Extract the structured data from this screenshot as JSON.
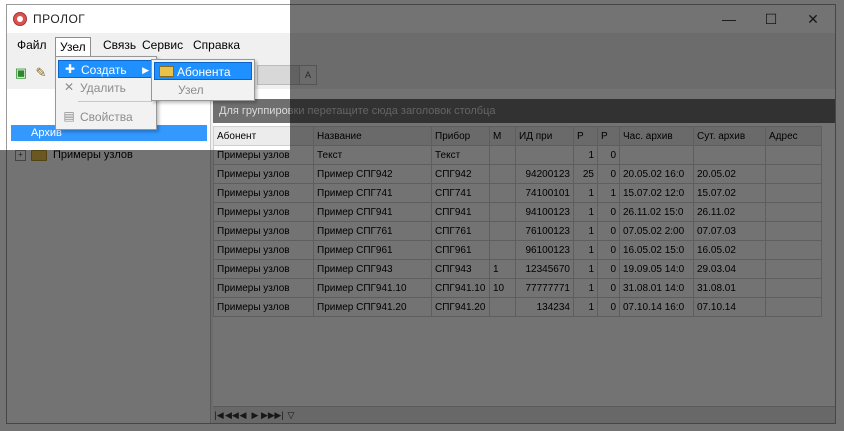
{
  "window": {
    "title": "ПРОЛОГ",
    "minimize": "—",
    "maximize": "☐",
    "close": "✕"
  },
  "menu": {
    "file": "Файл",
    "node": "Узел",
    "link": "Связь",
    "service": "Сервис",
    "help": "Справка"
  },
  "node_menu": {
    "create": "Создать",
    "delete": "Удалить",
    "properties": "Свойства"
  },
  "create_submenu": {
    "subscriber": "Абонента",
    "node": "Узел"
  },
  "tree": {
    "root": "Архив",
    "child": "Примеры узлов"
  },
  "grid": {
    "group_hint": "Для группировки перетащите сюда заголовок столбца",
    "headers": [
      "Абонент",
      "Название",
      "Прибор",
      "М",
      "ИД при",
      "Р",
      "Р",
      "Час. архив",
      "Сут. архив",
      "Адрес"
    ],
    "filter_row": [
      "Примеры узлов",
      "Текст",
      "Текст",
      "",
      "",
      "1",
      "0",
      "",
      "",
      ""
    ],
    "rows": [
      [
        "Примеры узлов",
        "Пример СПГ942",
        "СПГ942",
        "",
        "94200123",
        "25",
        "0",
        "20.05.02 16:0",
        "20.05.02",
        ""
      ],
      [
        "Примеры узлов",
        "Пример СПГ741",
        "СПГ741",
        "",
        "74100101",
        "1",
        "1",
        "15.07.02 12:0",
        "15.07.02",
        ""
      ],
      [
        "Примеры узлов",
        "Пример СПГ941",
        "СПГ941",
        "",
        "94100123",
        "1",
        "0",
        "26.11.02 15:0",
        "26.11.02",
        ""
      ],
      [
        "Примеры узлов",
        "Пример СПГ761",
        "СПГ761",
        "",
        "76100123",
        "1",
        "0",
        "07.05.02 2:00",
        "07.07.03",
        ""
      ],
      [
        "Примеры узлов",
        "Пример СПГ961",
        "СПГ961",
        "",
        "96100123",
        "1",
        "0",
        "16.05.02 15:0",
        "16.05.02",
        ""
      ],
      [
        "Примеры узлов",
        "Пример СПГ943",
        "СПГ943",
        "1",
        "12345670",
        "1",
        "0",
        "19.09.05 14:0",
        "29.03.04",
        ""
      ],
      [
        "Примеры узлов",
        "Пример СПГ941.10",
        "СПГ941.10",
        "10",
        "77777771",
        "1",
        "0",
        "31.08.01 14:0",
        "31.08.01",
        ""
      ],
      [
        "Примеры узлов",
        "Пример СПГ941.20",
        "СПГ941.20",
        "",
        "134234",
        "1",
        "0",
        "07.10.14 16:0",
        "07.10.14",
        ""
      ]
    ]
  },
  "colors": {
    "highlight": "#1e90ff",
    "tree_selected": "#3399ff"
  }
}
